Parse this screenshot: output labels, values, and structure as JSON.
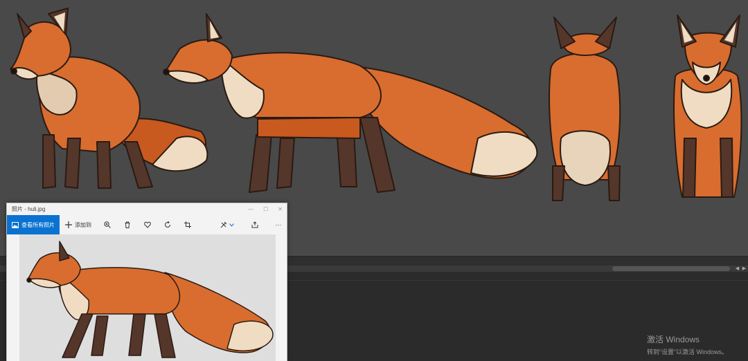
{
  "photos_window": {
    "title": "照片 - huli.jpg",
    "controls": {
      "minimize": "—",
      "maximize": "☐",
      "close": "✕"
    },
    "toolbar": {
      "see_all_label": "查看所有照片",
      "add_to_label": "添加到",
      "more_label": "···"
    }
  },
  "icons": [
    "image-icon",
    "plus-icon",
    "zoom-in-icon",
    "delete-icon",
    "heart-icon",
    "rotate-icon",
    "crop-icon",
    "edit-icon",
    "chevron-down-icon",
    "share-icon",
    "more-icon"
  ],
  "colors": {
    "viewport_bg": "#494949",
    "fur_orange": "#d86d2f",
    "fur_dark": "#b5521d",
    "fur_cream": "#efdcc2",
    "legs_dark": "#55362a",
    "accent_blue": "#0a72d1"
  },
  "watermark": {
    "title": "激活 Windows",
    "subtitle": "转到“设置”以激活 Windows。"
  }
}
